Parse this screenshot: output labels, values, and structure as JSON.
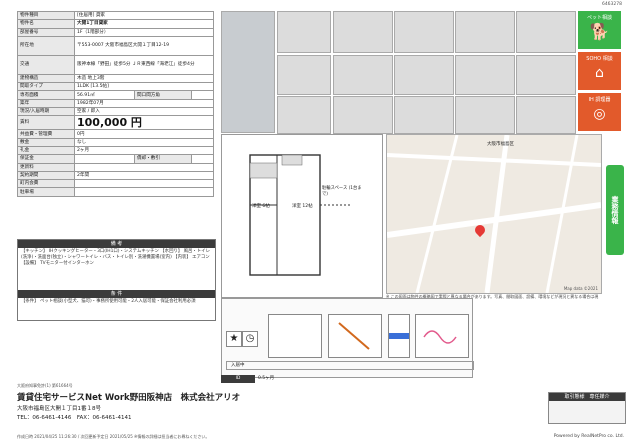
{
  "doc_id": "6463278",
  "spec": [
    {
      "k": "物件種目",
      "v": "[住居用] 貸家"
    },
    {
      "k": "物件名",
      "v": "大開1丁目貸家",
      "bold": true
    },
    {
      "k": "部屋番号",
      "v": "1F（1階部分）"
    },
    {
      "k": "所在地",
      "v": "〒553-0007 大阪市福島区大開１丁目12-19",
      "tall": true
    },
    {
      "k": "交通",
      "v": "阪神本線「野田」徒歩5分 ＪＲ東西線「海老江」徒歩4分",
      "tall": true
    },
    {
      "k": "建物構造",
      "v": "木造 地上3階"
    },
    {
      "k": "間取タイプ",
      "v": "1LDK [13.5帖]"
    },
    {
      "k": "専有面積",
      "v": "56.91㎡",
      "k2": "間口間方角"
    },
    {
      "k": "築年",
      "v": "1982年07月"
    },
    {
      "k": "現況/入居時期",
      "v": "空家 / 即入"
    },
    {
      "k": "賃料",
      "v": "100,000 円",
      "price": true
    },
    {
      "k": "共益費・管理費",
      "v": "0円"
    },
    {
      "k": "敷金",
      "v": "なし"
    },
    {
      "k": "礼金",
      "v": "2ヶ月"
    },
    {
      "k": "保証金",
      "v": "",
      "k2": "償却・敷引"
    },
    {
      "k": "更新料",
      "v": ""
    },
    {
      "k": "契約期間",
      "v": "2年間"
    },
    {
      "k": "町内会費",
      "v": ""
    },
    {
      "k": "駐車場",
      "v": ""
    }
  ],
  "remarks_title": "備 考",
  "remarks": "【キッチン】 IHクッキングヒーター・3口(IH1口)・システムキッチン 【水回り】 風呂・トイレ(洗浄)・洗面台(独立)・シャワートイレ・バス・トイレ別・洗濯機置場(室内) 【内装】 エアコン 【設備】 TVモニター付インターホン",
  "conditions_title": "条 件",
  "conditions": "【条件】 ペット相談(小型犬、猫可)・事務所使用可能・2人入居可能・保証会社利用必須",
  "badges": [
    {
      "label": "ペット相談",
      "color": "#3ab44a"
    },
    {
      "label": "SOHO 相談",
      "color": "#e25a2b"
    },
    {
      "label": "IH 調理器",
      "color": "#e25a2b"
    }
  ],
  "floorplan": {
    "room1": "洋室 6帖",
    "room2": "洋室 12帖",
    "label": "駐輪スペース (1台まで)"
  },
  "map": {
    "road_label": "大阪市福島区",
    "copyright": "Map data ©2021"
  },
  "map_note": "※ この図面は物件の概略図で実際と異なる場合があります。写真、間取図面、設備、環境などが現況と異なる場合は現況を優先します。",
  "sidebar_label": "業務情報",
  "tools": {
    "status_label": "入居中",
    "extra": "0.5ヶ月"
  },
  "footer": {
    "license": "大阪府知事免許(1) 第61664号",
    "company": "賃貸住宅サービスNet Work野田阪神店　株式会社アリオ",
    "address": "大阪市福島区大開１丁目1番１8号",
    "tel": "TEL：06-6461-4146　FAX：06-6461-4141",
    "printed": "作成日時 2021/04/25 11:26:30 / 次回更新予定日 2021/05/25 ※情報の詳細は担当者にお尋ねください。",
    "trade_title": "取引態様　専任媒介",
    "powered": "Powered by RealNetPro co. Ltd."
  }
}
